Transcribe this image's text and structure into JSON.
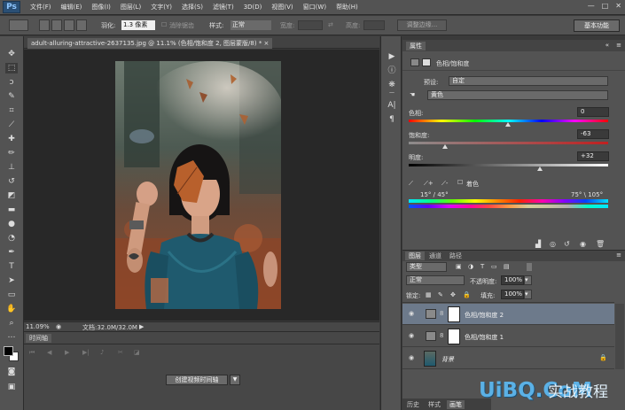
{
  "menubar": {
    "logo": "Ps",
    "items": [
      "文件(F)",
      "编辑(E)",
      "图像(I)",
      "图层(L)",
      "文字(Y)",
      "选择(S)",
      "滤镜(T)",
      "3D(D)",
      "视图(V)",
      "窗口(W)",
      "帮助(H)"
    ],
    "window_controls": [
      "—",
      "□",
      "✕"
    ]
  },
  "options_bar": {
    "feather_label": "羽化:",
    "feather_value": "1.3 像素",
    "antialias_label": "消除锯齿",
    "style_label": "样式:",
    "style_value": "正常",
    "width_label": "宽度:",
    "height_label": "高度:",
    "refine_edge": "调整边缘...",
    "workspace": "基本功能"
  },
  "document": {
    "tab_title": "adult-alluring-attractive-2637135.jpg @ 11.1% (色相/饱和度 2, 图层蒙版/8) *  ×",
    "zoom": "11.09%",
    "doc_size": "文档:32.0M/32.0M"
  },
  "timeline": {
    "tab": "时间轴",
    "create_button": "创建视频时间轴"
  },
  "properties": {
    "tab": "属性",
    "title": "色相/饱和度",
    "preset_label": "预设:",
    "preset_value": "自定",
    "channel_value": "黄色",
    "hue_label": "色相:",
    "hue_value": "0",
    "saturation_label": "饱和度:",
    "saturation_value": "-63",
    "lightness_label": "明度:",
    "lightness_value": "+32",
    "colorize_label": "着色",
    "range_left": "15° / 45°",
    "range_right": "75° \\ 105°"
  },
  "layers": {
    "tabs": [
      "图层",
      "通道",
      "路径"
    ],
    "filter_value": "类型",
    "blend_value": "正常",
    "opacity_label": "不透明度:",
    "opacity_value": "100%",
    "lock_label": "锁定:",
    "fill_label": "填充:",
    "fill_value": "100%",
    "rows": [
      {
        "name": "色相/饱和度 2"
      },
      {
        "name": "色相/饱和度 1"
      },
      {
        "name": "背景"
      }
    ]
  },
  "bottom_tabs": [
    "历史",
    "样式",
    "画笔"
  ],
  "watermark": {
    "logo": "UiBQ.CoM",
    "cn": "实战教程"
  },
  "colors": {
    "panel": "#535353",
    "canvas_bg": "#282828",
    "selected_layer": "#6d7a8b",
    "watermark_blue": "#5bb1e6"
  }
}
